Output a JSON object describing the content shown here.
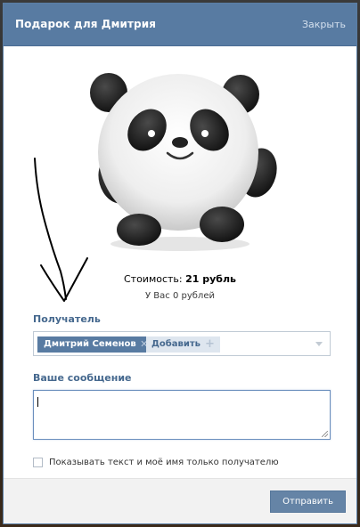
{
  "dialog": {
    "title": "Подарок для Дмитрия",
    "close_label": "Закрыть"
  },
  "gift": {
    "icon": "panda-gift-icon",
    "cost_prefix": "Стоимость:",
    "cost_value": "21 рубль",
    "balance": "У Вас 0 рублей"
  },
  "recipient": {
    "label": "Получатель",
    "chip_name": "Дмитрий Семенов",
    "add_label": "Добавить"
  },
  "message": {
    "label": "Ваше сообщение",
    "value": ""
  },
  "privacy": {
    "label": "Показывать текст и моё имя только получателю",
    "checked": false
  },
  "footer": {
    "send_label": "Отправить"
  },
  "colors": {
    "header": "#587ba2",
    "accent_text": "#45688e",
    "button": "#6584a6"
  }
}
